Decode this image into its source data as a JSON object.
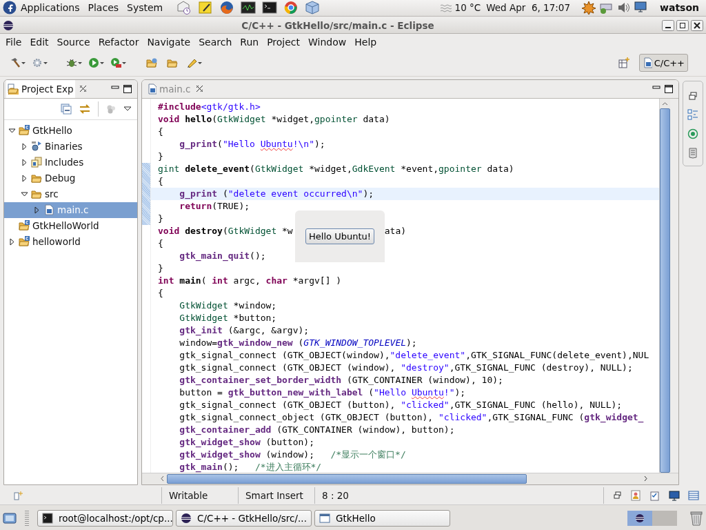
{
  "top_panel": {
    "menus": [
      "Applications",
      "Places",
      "System"
    ],
    "weather": "10 °C",
    "clock": "Wed Apr  6, 17:07",
    "user": "watson"
  },
  "window": {
    "title": "C/C++ - GtkHello/src/main.c - Eclipse"
  },
  "menu_bar": [
    "File",
    "Edit",
    "Source",
    "Refactor",
    "Navigate",
    "Search",
    "Run",
    "Project",
    "Window",
    "Help"
  ],
  "perspective": {
    "label": "C/C++",
    "selected": true
  },
  "project_explorer": {
    "title": "Project Exp",
    "tree": [
      {
        "label": "GtkHello",
        "kind": "project",
        "expandable": true,
        "expanded": true,
        "selected": false,
        "children": [
          {
            "label": "Binaries",
            "kind": "binaries",
            "expandable": true,
            "expanded": false,
            "selected": false
          },
          {
            "label": "Includes",
            "kind": "includes",
            "expandable": true,
            "expanded": false,
            "selected": false
          },
          {
            "label": "Debug",
            "kind": "folder",
            "expandable": true,
            "expanded": false,
            "selected": false
          },
          {
            "label": "src",
            "kind": "folder",
            "expandable": true,
            "expanded": true,
            "selected": false,
            "children": [
              {
                "label": "main.c",
                "kind": "source",
                "expandable": true,
                "expanded": false,
                "selected": true
              }
            ]
          }
        ]
      },
      {
        "label": "GtkHelloWorld",
        "kind": "project",
        "expandable": false,
        "expanded": false,
        "selected": false
      },
      {
        "label": "helloworld",
        "kind": "project",
        "expandable": true,
        "expanded": false,
        "selected": false
      }
    ]
  },
  "editor": {
    "tab": "main.c",
    "lines": [
      {
        "current": false,
        "changed": false,
        "tokens": [
          {
            "kind": "pre",
            "t": "#include"
          },
          {
            "kind": "inc",
            "t": "<gtk/gtk.h>"
          }
        ]
      },
      {
        "current": false,
        "changed": false,
        "tokens": [
          {
            "kind": "kw",
            "t": "void "
          },
          {
            "kind": "fn",
            "t": "hello"
          },
          {
            "kind": "plain",
            "t": "("
          },
          {
            "kind": "type",
            "t": "GtkWidget"
          },
          {
            "kind": "plain",
            "t": " *widget,"
          },
          {
            "kind": "type",
            "t": "gpointer"
          },
          {
            "kind": "plain",
            "t": " data)"
          }
        ]
      },
      {
        "current": false,
        "changed": false,
        "tokens": [
          {
            "kind": "plain",
            "t": "{"
          }
        ]
      },
      {
        "current": false,
        "changed": false,
        "tokens": [
          {
            "kind": "call",
            "t": "    g_print"
          },
          {
            "kind": "plain",
            "t": "("
          },
          {
            "kind": "str",
            "t": "\"Hello "
          },
          {
            "kind": "typo",
            "t": "Ubuntu"
          },
          {
            "kind": "str",
            "t": "!\\n\""
          },
          {
            "kind": "plain",
            "t": ");"
          }
        ]
      },
      {
        "current": false,
        "changed": false,
        "tokens": [
          {
            "kind": "plain",
            "t": "}"
          }
        ]
      },
      {
        "current": false,
        "changed": true,
        "tokens": [
          {
            "kind": "type",
            "t": "gint "
          },
          {
            "kind": "fn",
            "t": "delete_event"
          },
          {
            "kind": "plain",
            "t": "("
          },
          {
            "kind": "type",
            "t": "GtkWidget"
          },
          {
            "kind": "plain",
            "t": " *widget,"
          },
          {
            "kind": "type",
            "t": "GdkEvent"
          },
          {
            "kind": "plain",
            "t": " *event,"
          },
          {
            "kind": "type",
            "t": "gpointer"
          },
          {
            "kind": "plain",
            "t": " data)"
          }
        ]
      },
      {
        "current": false,
        "changed": true,
        "tokens": [
          {
            "kind": "plain",
            "t": "{"
          }
        ]
      },
      {
        "current": true,
        "changed": true,
        "tokens": [
          {
            "kind": "call",
            "t": "    g_print"
          },
          {
            "kind": "plain",
            "t": " ("
          },
          {
            "kind": "str",
            "t": "\"delete event occurred\\n\""
          },
          {
            "kind": "plain",
            "t": ");"
          }
        ]
      },
      {
        "current": false,
        "changed": true,
        "tokens": [
          {
            "kind": "kw",
            "t": "    return"
          },
          {
            "kind": "plain",
            "t": "(TRUE);"
          }
        ]
      },
      {
        "current": false,
        "changed": true,
        "tokens": [
          {
            "kind": "plain",
            "t": "}"
          }
        ]
      },
      {
        "current": false,
        "changed": false,
        "tokens": [
          {
            "kind": "kw",
            "t": "void "
          },
          {
            "kind": "fn",
            "t": "destroy"
          },
          {
            "kind": "plain",
            "t": "("
          },
          {
            "kind": "type",
            "t": "GtkWidget"
          },
          {
            "kind": "plain",
            "t": " *w"
          }
        ],
        "after_popup": [
          {
            "kind": "plain",
            "t": "ata)"
          }
        ]
      },
      {
        "current": false,
        "changed": false,
        "tokens": [
          {
            "kind": "plain",
            "t": "{"
          }
        ]
      },
      {
        "current": false,
        "changed": false,
        "tokens": [
          {
            "kind": "call",
            "t": "    gtk_main_quit"
          },
          {
            "kind": "plain",
            "t": "();"
          }
        ]
      },
      {
        "current": false,
        "changed": false,
        "tokens": [
          {
            "kind": "plain",
            "t": "}"
          }
        ]
      },
      {
        "current": false,
        "changed": false,
        "tokens": [
          {
            "kind": "kw",
            "t": "int "
          },
          {
            "kind": "fn",
            "t": "main"
          },
          {
            "kind": "plain",
            "t": "( "
          },
          {
            "kind": "kw",
            "t": "int"
          },
          {
            "kind": "plain",
            "t": " argc, "
          },
          {
            "kind": "kw",
            "t": "char"
          },
          {
            "kind": "plain",
            "t": " *argv[] )"
          }
        ]
      },
      {
        "current": false,
        "changed": false,
        "tokens": [
          {
            "kind": "plain",
            "t": "{"
          }
        ]
      },
      {
        "current": false,
        "changed": false,
        "tokens": [
          {
            "kind": "type",
            "t": "    GtkWidget"
          },
          {
            "kind": "plain",
            "t": " *window;"
          }
        ]
      },
      {
        "current": false,
        "changed": false,
        "tokens": [
          {
            "kind": "type",
            "t": "    GtkWidget"
          },
          {
            "kind": "plain",
            "t": " *button;"
          }
        ]
      },
      {
        "current": false,
        "changed": false,
        "tokens": [
          {
            "kind": "call",
            "t": "    gtk_init"
          },
          {
            "kind": "plain",
            "t": " (&argc, &argv);"
          }
        ]
      },
      {
        "current": false,
        "changed": false,
        "tokens": [
          {
            "kind": "plain",
            "t": "    window="
          },
          {
            "kind": "call",
            "t": "gtk_window_new"
          },
          {
            "kind": "plain",
            "t": " ("
          },
          {
            "kind": "macro",
            "t": "GTK_WINDOW_TOPLEVEL"
          },
          {
            "kind": "plain",
            "t": ");"
          }
        ]
      },
      {
        "current": false,
        "changed": false,
        "tokens": [
          {
            "kind": "plain",
            "t": "    gtk_signal_connect (GTK_OBJECT(window),"
          },
          {
            "kind": "str",
            "t": "\"delete_event\""
          },
          {
            "kind": "plain",
            "t": ",GTK_SIGNAL_FUNC(delete_event),NUL"
          }
        ]
      },
      {
        "current": false,
        "changed": false,
        "tokens": [
          {
            "kind": "plain",
            "t": "    gtk_signal_connect (GTK_OBJECT (window), "
          },
          {
            "kind": "str",
            "t": "\"destroy\""
          },
          {
            "kind": "plain",
            "t": ",GTK_SIGNAL_FUNC (destroy), NULL);"
          }
        ]
      },
      {
        "current": false,
        "changed": false,
        "tokens": [
          {
            "kind": "call",
            "t": "    gtk_container_set_border_width"
          },
          {
            "kind": "plain",
            "t": " (GTK_CONTAINER (window), 10);"
          }
        ]
      },
      {
        "current": false,
        "changed": false,
        "tokens": [
          {
            "kind": "plain",
            "t": "    button = "
          },
          {
            "kind": "call",
            "t": "gtk_button_new_with_label"
          },
          {
            "kind": "plain",
            "t": " ("
          },
          {
            "kind": "str",
            "t": "\"Hello "
          },
          {
            "kind": "typo",
            "t": "Ubuntu"
          },
          {
            "kind": "str",
            "t": "!\""
          },
          {
            "kind": "plain",
            "t": ");"
          }
        ]
      },
      {
        "current": false,
        "changed": false,
        "tokens": [
          {
            "kind": "plain",
            "t": "    gtk_signal_connect (GTK_OBJECT (button), "
          },
          {
            "kind": "str",
            "t": "\"clicked\""
          },
          {
            "kind": "plain",
            "t": ",GTK_SIGNAL_FUNC (hello), NULL);"
          }
        ]
      },
      {
        "current": false,
        "changed": false,
        "tokens": [
          {
            "kind": "plain",
            "t": "    gtk_signal_connect_object (GTK_OBJECT (button), "
          },
          {
            "kind": "str",
            "t": "\"clicked\""
          },
          {
            "kind": "plain",
            "t": ",GTK_SIGNAL_FUNC ("
          },
          {
            "kind": "call",
            "t": "gtk_widget_"
          }
        ]
      },
      {
        "current": false,
        "changed": false,
        "tokens": [
          {
            "kind": "call",
            "t": "    gtk_container_add"
          },
          {
            "kind": "plain",
            "t": " (GTK_CONTAINER (window), button);"
          }
        ]
      },
      {
        "current": false,
        "changed": false,
        "tokens": [
          {
            "kind": "call",
            "t": "    gtk_widget_show"
          },
          {
            "kind": "plain",
            "t": " (button);"
          }
        ]
      },
      {
        "current": false,
        "changed": false,
        "tokens": [
          {
            "kind": "call",
            "t": "    gtk_widget_show"
          },
          {
            "kind": "plain",
            "t": " (window);   "
          },
          {
            "kind": "cmt",
            "t": "/*显示一个窗口*/"
          }
        ]
      },
      {
        "current": false,
        "changed": false,
        "tokens": [
          {
            "kind": "call",
            "t": "    gtk_main"
          },
          {
            "kind": "plain",
            "t": "();   "
          },
          {
            "kind": "cmt",
            "t": "/*进入主循环*/"
          }
        ]
      }
    ]
  },
  "popup_window": {
    "button": "Hello Ubuntu!"
  },
  "status_bar": [
    "Writable",
    "Smart Insert",
    "8 : 20"
  ],
  "taskbar": {
    "tasks": [
      {
        "kind": "terminal",
        "label": "root@localhost:/opt/cp..."
      },
      {
        "kind": "eclipse",
        "label": "C/C++ - GtkHello/src/..."
      },
      {
        "kind": "window",
        "label": "GtkHello"
      }
    ],
    "workspaces": [
      {
        "selected": true
      },
      {
        "selected": false
      }
    ]
  }
}
